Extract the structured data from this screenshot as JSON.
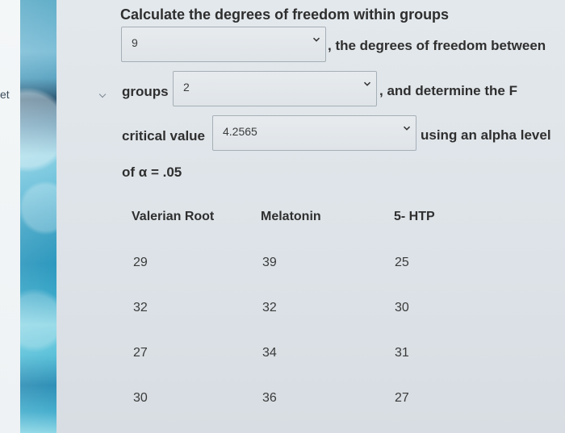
{
  "sidebar": {
    "label": "et"
  },
  "prompt": {
    "heading": "Calculate the degrees of freedom within groups",
    "after_first_select": ", the degrees of freedom between",
    "groups_label": "groups",
    "after_second_select": ", and determine the F",
    "critical_label": "critical value",
    "after_third_select": "using an alpha level",
    "alpha_text": "of α = .05"
  },
  "selects": {
    "df_within": "9",
    "df_between": "2",
    "f_critical": "4.2565"
  },
  "table": {
    "headers": [
      "Valerian Root",
      "Melatonin",
      "5- HTP"
    ],
    "rows": [
      [
        "29",
        "39",
        "25"
      ],
      [
        "32",
        "32",
        "30"
      ],
      [
        "27",
        "34",
        "31"
      ],
      [
        "30",
        "36",
        "27"
      ]
    ]
  },
  "icons": {
    "chevron": "chevron-down-icon",
    "tiny_mark": "chevron-right-icon"
  },
  "colors": {
    "text": "#2f2f2f",
    "border": "#a6afb7",
    "ocean_light": "#8ad0e3",
    "ocean_dark": "#2c5773"
  }
}
